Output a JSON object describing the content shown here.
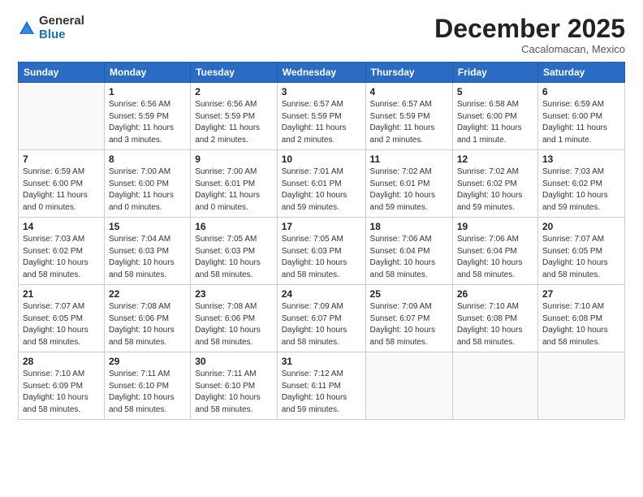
{
  "header": {
    "logo_general": "General",
    "logo_blue": "Blue",
    "month_title": "December 2025",
    "location": "Cacalomacan, Mexico"
  },
  "weekdays": [
    "Sunday",
    "Monday",
    "Tuesday",
    "Wednesday",
    "Thursday",
    "Friday",
    "Saturday"
  ],
  "weeks": [
    [
      {
        "day": "",
        "info": ""
      },
      {
        "day": "1",
        "info": "Sunrise: 6:56 AM\nSunset: 5:59 PM\nDaylight: 11 hours\nand 3 minutes."
      },
      {
        "day": "2",
        "info": "Sunrise: 6:56 AM\nSunset: 5:59 PM\nDaylight: 11 hours\nand 2 minutes."
      },
      {
        "day": "3",
        "info": "Sunrise: 6:57 AM\nSunset: 5:59 PM\nDaylight: 11 hours\nand 2 minutes."
      },
      {
        "day": "4",
        "info": "Sunrise: 6:57 AM\nSunset: 5:59 PM\nDaylight: 11 hours\nand 2 minutes."
      },
      {
        "day": "5",
        "info": "Sunrise: 6:58 AM\nSunset: 6:00 PM\nDaylight: 11 hours\nand 1 minute."
      },
      {
        "day": "6",
        "info": "Sunrise: 6:59 AM\nSunset: 6:00 PM\nDaylight: 11 hours\nand 1 minute."
      }
    ],
    [
      {
        "day": "7",
        "info": "Sunrise: 6:59 AM\nSunset: 6:00 PM\nDaylight: 11 hours\nand 0 minutes."
      },
      {
        "day": "8",
        "info": "Sunrise: 7:00 AM\nSunset: 6:00 PM\nDaylight: 11 hours\nand 0 minutes."
      },
      {
        "day": "9",
        "info": "Sunrise: 7:00 AM\nSunset: 6:01 PM\nDaylight: 11 hours\nand 0 minutes."
      },
      {
        "day": "10",
        "info": "Sunrise: 7:01 AM\nSunset: 6:01 PM\nDaylight: 10 hours\nand 59 minutes."
      },
      {
        "day": "11",
        "info": "Sunrise: 7:02 AM\nSunset: 6:01 PM\nDaylight: 10 hours\nand 59 minutes."
      },
      {
        "day": "12",
        "info": "Sunrise: 7:02 AM\nSunset: 6:02 PM\nDaylight: 10 hours\nand 59 minutes."
      },
      {
        "day": "13",
        "info": "Sunrise: 7:03 AM\nSunset: 6:02 PM\nDaylight: 10 hours\nand 59 minutes."
      }
    ],
    [
      {
        "day": "14",
        "info": "Sunrise: 7:03 AM\nSunset: 6:02 PM\nDaylight: 10 hours\nand 58 minutes."
      },
      {
        "day": "15",
        "info": "Sunrise: 7:04 AM\nSunset: 6:03 PM\nDaylight: 10 hours\nand 58 minutes."
      },
      {
        "day": "16",
        "info": "Sunrise: 7:05 AM\nSunset: 6:03 PM\nDaylight: 10 hours\nand 58 minutes."
      },
      {
        "day": "17",
        "info": "Sunrise: 7:05 AM\nSunset: 6:03 PM\nDaylight: 10 hours\nand 58 minutes."
      },
      {
        "day": "18",
        "info": "Sunrise: 7:06 AM\nSunset: 6:04 PM\nDaylight: 10 hours\nand 58 minutes."
      },
      {
        "day": "19",
        "info": "Sunrise: 7:06 AM\nSunset: 6:04 PM\nDaylight: 10 hours\nand 58 minutes."
      },
      {
        "day": "20",
        "info": "Sunrise: 7:07 AM\nSunset: 6:05 PM\nDaylight: 10 hours\nand 58 minutes."
      }
    ],
    [
      {
        "day": "21",
        "info": "Sunrise: 7:07 AM\nSunset: 6:05 PM\nDaylight: 10 hours\nand 58 minutes."
      },
      {
        "day": "22",
        "info": "Sunrise: 7:08 AM\nSunset: 6:06 PM\nDaylight: 10 hours\nand 58 minutes."
      },
      {
        "day": "23",
        "info": "Sunrise: 7:08 AM\nSunset: 6:06 PM\nDaylight: 10 hours\nand 58 minutes."
      },
      {
        "day": "24",
        "info": "Sunrise: 7:09 AM\nSunset: 6:07 PM\nDaylight: 10 hours\nand 58 minutes."
      },
      {
        "day": "25",
        "info": "Sunrise: 7:09 AM\nSunset: 6:07 PM\nDaylight: 10 hours\nand 58 minutes."
      },
      {
        "day": "26",
        "info": "Sunrise: 7:10 AM\nSunset: 6:08 PM\nDaylight: 10 hours\nand 58 minutes."
      },
      {
        "day": "27",
        "info": "Sunrise: 7:10 AM\nSunset: 6:08 PM\nDaylight: 10 hours\nand 58 minutes."
      }
    ],
    [
      {
        "day": "28",
        "info": "Sunrise: 7:10 AM\nSunset: 6:09 PM\nDaylight: 10 hours\nand 58 minutes."
      },
      {
        "day": "29",
        "info": "Sunrise: 7:11 AM\nSunset: 6:10 PM\nDaylight: 10 hours\nand 58 minutes."
      },
      {
        "day": "30",
        "info": "Sunrise: 7:11 AM\nSunset: 6:10 PM\nDaylight: 10 hours\nand 58 minutes."
      },
      {
        "day": "31",
        "info": "Sunrise: 7:12 AM\nSunset: 6:11 PM\nDaylight: 10 hours\nand 59 minutes."
      },
      {
        "day": "",
        "info": ""
      },
      {
        "day": "",
        "info": ""
      },
      {
        "day": "",
        "info": ""
      }
    ]
  ]
}
